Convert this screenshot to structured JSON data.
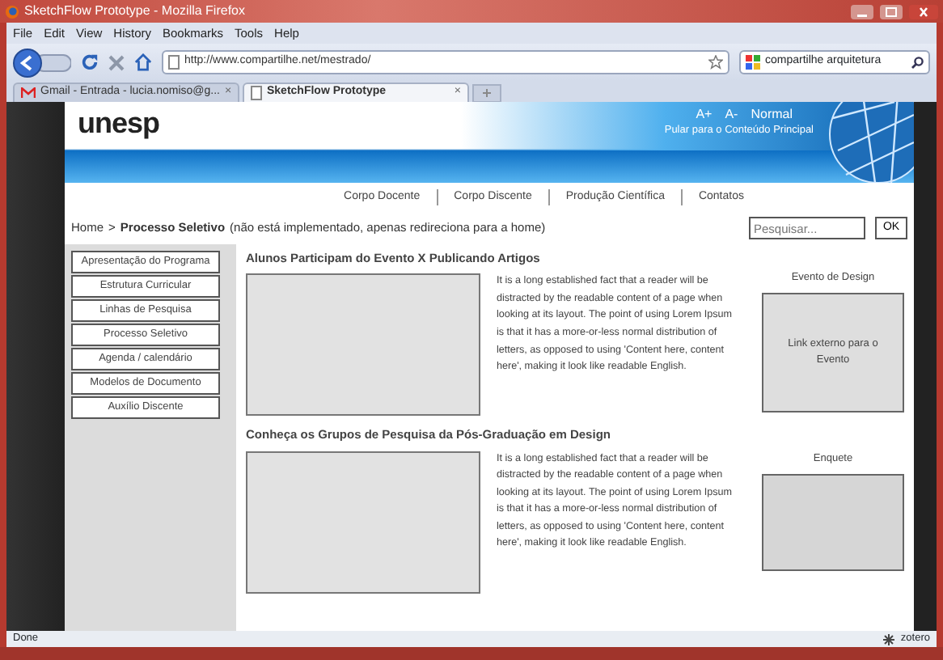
{
  "window": {
    "title": "SketchFlow Prototype - Mozilla Firefox"
  },
  "menu_bar": [
    "File",
    "Edit",
    "View",
    "History",
    "Bookmarks",
    "Tools",
    "Help"
  ],
  "toolbar": {
    "address": "http://www.compartilhe.net/mestrado/",
    "search_value": "compartilhe arquitetura"
  },
  "tabs": [
    {
      "label": "Gmail - Entrada - lucia.nomiso@g...",
      "close": "×",
      "selected": false,
      "kind": "mail"
    },
    {
      "label": "SketchFlow Prototype",
      "close": "×",
      "selected": true,
      "kind": "page"
    }
  ],
  "page": {
    "logo": "unesp",
    "font_controls": [
      "A+",
      "A-",
      "Normal"
    ],
    "skip_link": "Pular para o Conteúdo Principal",
    "nav": [
      "Corpo Docente",
      "Corpo Discente",
      "Produção Científica",
      "Contatos"
    ],
    "breadcrumb": {
      "home": "Home",
      "separator": ">",
      "current": "Processo Seletivo",
      "note": "(não está implementado, apenas redireciona para a home)"
    },
    "search": {
      "placeholder": "Pesquisar...",
      "button": "OK"
    },
    "sidebar": [
      "Apresentação do Programa",
      "Estrutura Curricular",
      "Linhas de Pesquisa",
      "Processo Seletivo",
      "Agenda / calendário",
      "Modelos de Documento",
      "Auxílio Discente"
    ],
    "articles": [
      {
        "title": "Alunos Participam do Evento X Publicando Artigos",
        "body": "It is a long established fact that a reader will be distracted by the readable content of a page when looking at its layout. The point of using Lorem Ipsum is that it has a more-or-less normal distribution of letters, as opposed to using 'Content here, content here', making it look like readable English."
      },
      {
        "title": "Conheça os Grupos de Pesquisa da Pós-Graduação em Design",
        "body": "It is a long established fact that a reader will be distracted by the readable content of a page when looking at its layout. The point of using Lorem Ipsum is that it has a more-or-less normal distribution of letters, as opposed to using 'Content here, content here', making it look like readable English."
      }
    ],
    "aside": [
      {
        "heading": "Evento de Design",
        "link": "Link externo para o Evento"
      },
      {
        "heading": "Enquete"
      }
    ]
  },
  "status_bar": {
    "text": "Done",
    "addon": "zotero"
  }
}
